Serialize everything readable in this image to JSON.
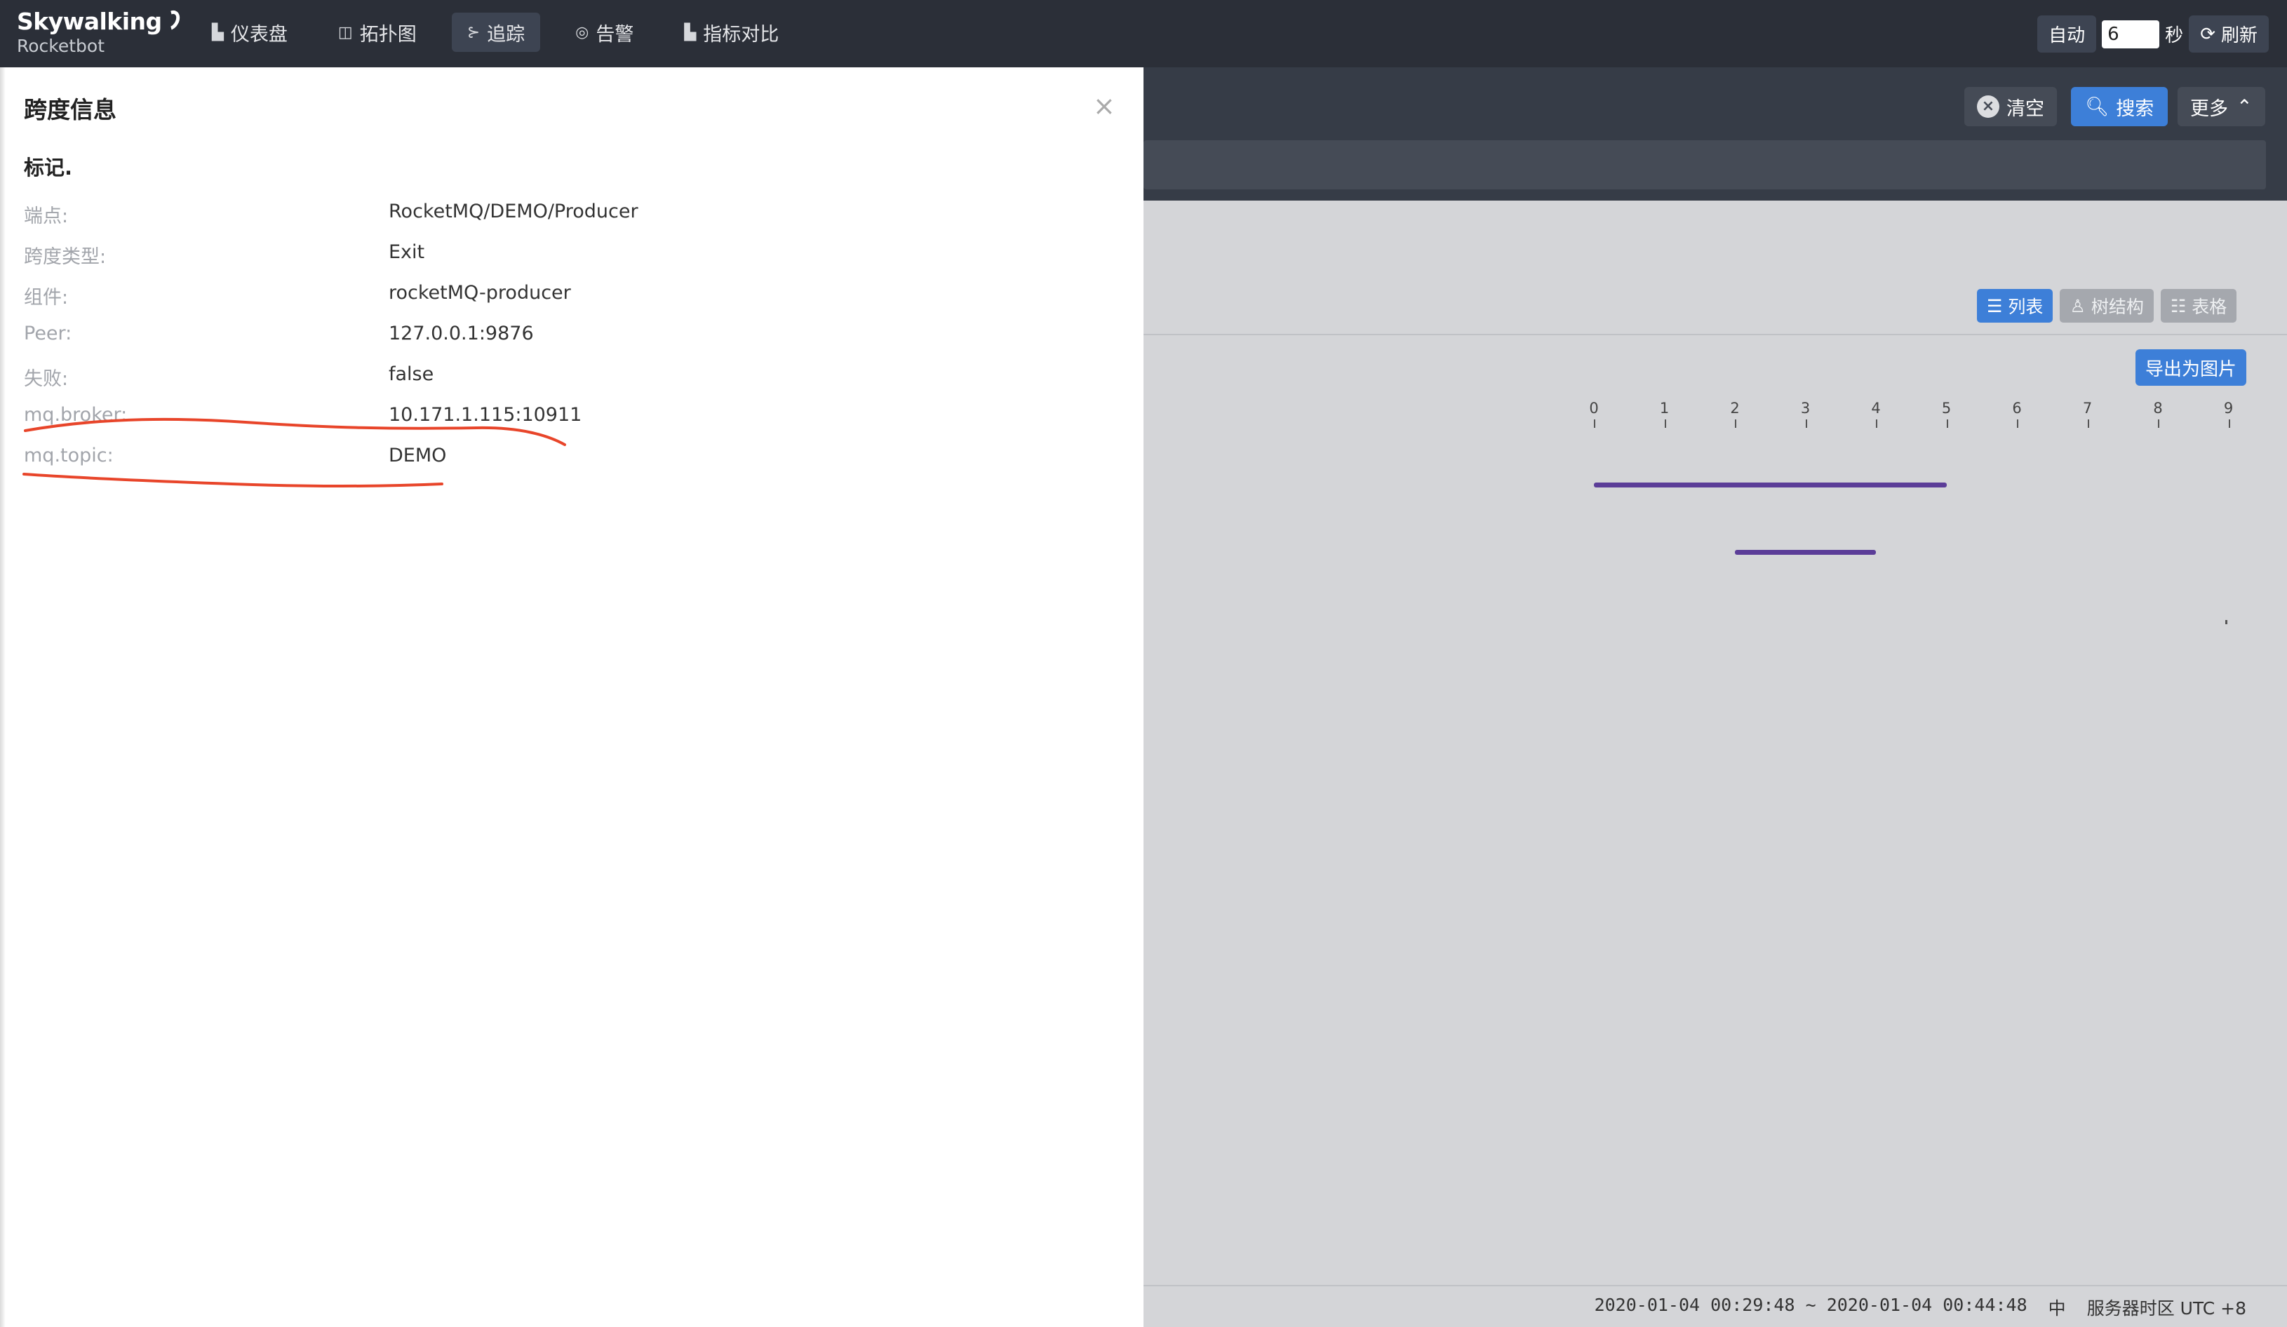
{
  "app": {
    "logo_main": "Skywalking",
    "logo_sub": "Rocketbot"
  },
  "nav": {
    "items": [
      {
        "label": "仪表盘",
        "icon": "chart-icon"
      },
      {
        "label": "拓扑图",
        "icon": "topology-icon"
      },
      {
        "label": "追踪",
        "icon": "trace-icon",
        "active": true
      },
      {
        "label": "告警",
        "icon": "alarm-icon"
      },
      {
        "label": "指标对比",
        "icon": "compare-icon"
      }
    ],
    "auto_label": "自动",
    "interval_value": "6",
    "interval_unit": "秒",
    "refresh_label": "刷新"
  },
  "toolbar": {
    "clear_label": "清空",
    "search_label": "搜索",
    "more_label": "更多"
  },
  "views": {
    "list_label": "列表",
    "tree_label": "树结构",
    "table_label": "表格",
    "export_label": "导出为图片"
  },
  "timeline": {
    "ticks": [
      "0",
      "1",
      "2",
      "3",
      "4",
      "5",
      "6",
      "7",
      "8",
      "9"
    ],
    "spans": [
      {
        "start": 0,
        "end": 5
      },
      {
        "start": 2,
        "end": 4
      }
    ]
  },
  "footer": {
    "time_range": "2020-01-04 00:29:48 ~ 2020-01-04 00:44:48",
    "lang": "中",
    "timezone": "服务器时区 UTC +8"
  },
  "panel": {
    "title": "跨度信息",
    "close": "×",
    "tags_title": "标记.",
    "rows": [
      {
        "key": "端点:",
        "value": "RocketMQ/DEMO/Producer"
      },
      {
        "key": "跨度类型:",
        "value": "Exit"
      },
      {
        "key": "组件:",
        "value": "rocketMQ-producer"
      },
      {
        "key": "Peer:",
        "value": "127.0.0.1:9876"
      },
      {
        "key": "失败:",
        "value": "false"
      },
      {
        "key": "mq.broker:",
        "value": "10.171.1.115:10911"
      },
      {
        "key": "mq.topic:",
        "value": "DEMO"
      }
    ]
  },
  "colors": {
    "accent": "#3d7fd8",
    "nav_bg": "#2b2f38",
    "span_bar": "#5b3d98",
    "annotation": "#e8452a"
  }
}
